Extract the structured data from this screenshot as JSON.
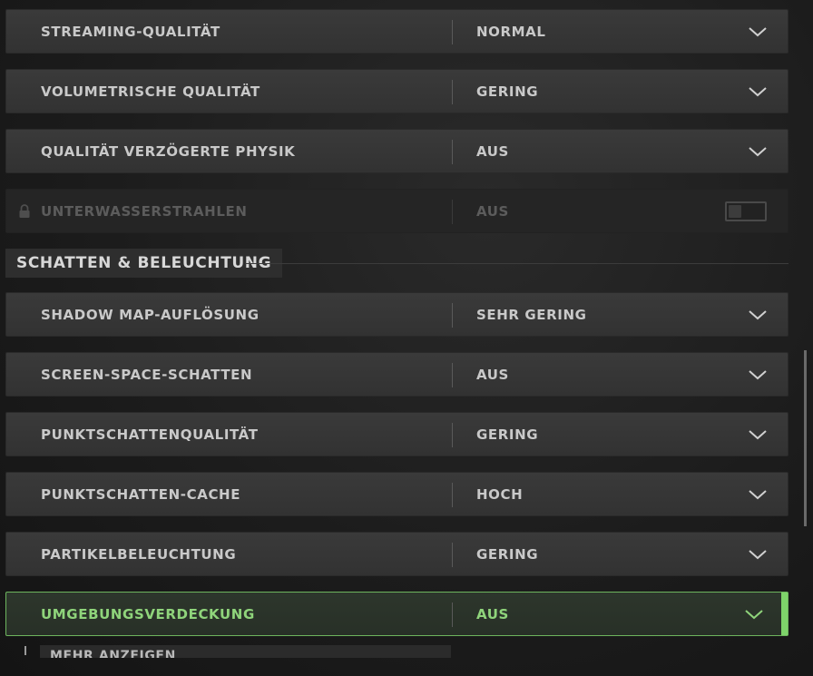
{
  "rows": [
    {
      "label": "STREAMING-QUALITÄT",
      "value": "NORMAL"
    },
    {
      "label": "VOLUMETRISCHE QUALITÄT",
      "value": "GERING"
    },
    {
      "label": "QUALITÄT VERZÖGERTE PHYSIK",
      "value": "AUS"
    },
    {
      "label": "UNTERWASSERSTRAHLEN",
      "value": "AUS"
    },
    {
      "label": "SHADOW MAP-AUFLÖSUNG",
      "value": "SEHR GERING"
    },
    {
      "label": "SCREEN-SPACE-SCHATTEN",
      "value": "AUS"
    },
    {
      "label": "PUNKTSCHATTENQUALITÄT",
      "value": "GERING"
    },
    {
      "label": "PUNKTSCHATTEN-CACHE",
      "value": "HOCH"
    },
    {
      "label": "PARTIKELBELEUCHTUNG",
      "value": "GERING"
    },
    {
      "label": "UMGEBUNGSVERDECKUNG",
      "value": "AUS"
    }
  ],
  "section": {
    "title": "SCHATTEN & BELEUCHTUNG"
  },
  "show_more_label": "MEHR ANZEIGEN",
  "colors": {
    "accent": "#7ed36a",
    "text": "#c9c9c9",
    "disabled_text": "#5c5c5c"
  },
  "icons": {
    "dropdown": "chevron-down-icon",
    "locked": "lock-icon"
  }
}
